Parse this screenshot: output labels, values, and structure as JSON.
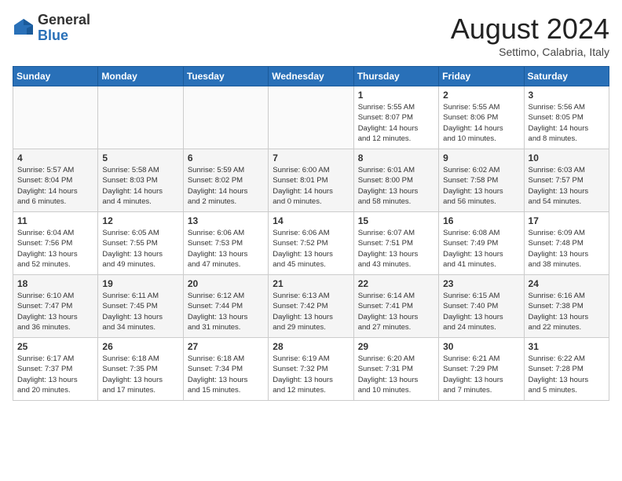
{
  "header": {
    "logo_general": "General",
    "logo_blue": "Blue",
    "month_title": "August 2024",
    "location": "Settimo, Calabria, Italy"
  },
  "days_of_week": [
    "Sunday",
    "Monday",
    "Tuesday",
    "Wednesday",
    "Thursday",
    "Friday",
    "Saturday"
  ],
  "weeks": [
    {
      "days": [
        {
          "num": "",
          "empty": true
        },
        {
          "num": "",
          "empty": true
        },
        {
          "num": "",
          "empty": true
        },
        {
          "num": "",
          "empty": true
        },
        {
          "num": "1",
          "lines": [
            "Sunrise: 5:55 AM",
            "Sunset: 8:07 PM",
            "Daylight: 14 hours",
            "and 12 minutes."
          ]
        },
        {
          "num": "2",
          "lines": [
            "Sunrise: 5:55 AM",
            "Sunset: 8:06 PM",
            "Daylight: 14 hours",
            "and 10 minutes."
          ]
        },
        {
          "num": "3",
          "lines": [
            "Sunrise: 5:56 AM",
            "Sunset: 8:05 PM",
            "Daylight: 14 hours",
            "and 8 minutes."
          ]
        }
      ]
    },
    {
      "days": [
        {
          "num": "4",
          "lines": [
            "Sunrise: 5:57 AM",
            "Sunset: 8:04 PM",
            "Daylight: 14 hours",
            "and 6 minutes."
          ]
        },
        {
          "num": "5",
          "lines": [
            "Sunrise: 5:58 AM",
            "Sunset: 8:03 PM",
            "Daylight: 14 hours",
            "and 4 minutes."
          ]
        },
        {
          "num": "6",
          "lines": [
            "Sunrise: 5:59 AM",
            "Sunset: 8:02 PM",
            "Daylight: 14 hours",
            "and 2 minutes."
          ]
        },
        {
          "num": "7",
          "lines": [
            "Sunrise: 6:00 AM",
            "Sunset: 8:01 PM",
            "Daylight: 14 hours",
            "and 0 minutes."
          ]
        },
        {
          "num": "8",
          "lines": [
            "Sunrise: 6:01 AM",
            "Sunset: 8:00 PM",
            "Daylight: 13 hours",
            "and 58 minutes."
          ]
        },
        {
          "num": "9",
          "lines": [
            "Sunrise: 6:02 AM",
            "Sunset: 7:58 PM",
            "Daylight: 13 hours",
            "and 56 minutes."
          ]
        },
        {
          "num": "10",
          "lines": [
            "Sunrise: 6:03 AM",
            "Sunset: 7:57 PM",
            "Daylight: 13 hours",
            "and 54 minutes."
          ]
        }
      ]
    },
    {
      "days": [
        {
          "num": "11",
          "lines": [
            "Sunrise: 6:04 AM",
            "Sunset: 7:56 PM",
            "Daylight: 13 hours",
            "and 52 minutes."
          ]
        },
        {
          "num": "12",
          "lines": [
            "Sunrise: 6:05 AM",
            "Sunset: 7:55 PM",
            "Daylight: 13 hours",
            "and 49 minutes."
          ]
        },
        {
          "num": "13",
          "lines": [
            "Sunrise: 6:06 AM",
            "Sunset: 7:53 PM",
            "Daylight: 13 hours",
            "and 47 minutes."
          ]
        },
        {
          "num": "14",
          "lines": [
            "Sunrise: 6:06 AM",
            "Sunset: 7:52 PM",
            "Daylight: 13 hours",
            "and 45 minutes."
          ]
        },
        {
          "num": "15",
          "lines": [
            "Sunrise: 6:07 AM",
            "Sunset: 7:51 PM",
            "Daylight: 13 hours",
            "and 43 minutes."
          ]
        },
        {
          "num": "16",
          "lines": [
            "Sunrise: 6:08 AM",
            "Sunset: 7:49 PM",
            "Daylight: 13 hours",
            "and 41 minutes."
          ]
        },
        {
          "num": "17",
          "lines": [
            "Sunrise: 6:09 AM",
            "Sunset: 7:48 PM",
            "Daylight: 13 hours",
            "and 38 minutes."
          ]
        }
      ]
    },
    {
      "days": [
        {
          "num": "18",
          "lines": [
            "Sunrise: 6:10 AM",
            "Sunset: 7:47 PM",
            "Daylight: 13 hours",
            "and 36 minutes."
          ]
        },
        {
          "num": "19",
          "lines": [
            "Sunrise: 6:11 AM",
            "Sunset: 7:45 PM",
            "Daylight: 13 hours",
            "and 34 minutes."
          ]
        },
        {
          "num": "20",
          "lines": [
            "Sunrise: 6:12 AM",
            "Sunset: 7:44 PM",
            "Daylight: 13 hours",
            "and 31 minutes."
          ]
        },
        {
          "num": "21",
          "lines": [
            "Sunrise: 6:13 AM",
            "Sunset: 7:42 PM",
            "Daylight: 13 hours",
            "and 29 minutes."
          ]
        },
        {
          "num": "22",
          "lines": [
            "Sunrise: 6:14 AM",
            "Sunset: 7:41 PM",
            "Daylight: 13 hours",
            "and 27 minutes."
          ]
        },
        {
          "num": "23",
          "lines": [
            "Sunrise: 6:15 AM",
            "Sunset: 7:40 PM",
            "Daylight: 13 hours",
            "and 24 minutes."
          ]
        },
        {
          "num": "24",
          "lines": [
            "Sunrise: 6:16 AM",
            "Sunset: 7:38 PM",
            "Daylight: 13 hours",
            "and 22 minutes."
          ]
        }
      ]
    },
    {
      "days": [
        {
          "num": "25",
          "lines": [
            "Sunrise: 6:17 AM",
            "Sunset: 7:37 PM",
            "Daylight: 13 hours",
            "and 20 minutes."
          ]
        },
        {
          "num": "26",
          "lines": [
            "Sunrise: 6:18 AM",
            "Sunset: 7:35 PM",
            "Daylight: 13 hours",
            "and 17 minutes."
          ]
        },
        {
          "num": "27",
          "lines": [
            "Sunrise: 6:18 AM",
            "Sunset: 7:34 PM",
            "Daylight: 13 hours",
            "and 15 minutes."
          ]
        },
        {
          "num": "28",
          "lines": [
            "Sunrise: 6:19 AM",
            "Sunset: 7:32 PM",
            "Daylight: 13 hours",
            "and 12 minutes."
          ]
        },
        {
          "num": "29",
          "lines": [
            "Sunrise: 6:20 AM",
            "Sunset: 7:31 PM",
            "Daylight: 13 hours",
            "and 10 minutes."
          ]
        },
        {
          "num": "30",
          "lines": [
            "Sunrise: 6:21 AM",
            "Sunset: 7:29 PM",
            "Daylight: 13 hours",
            "and 7 minutes."
          ]
        },
        {
          "num": "31",
          "lines": [
            "Sunrise: 6:22 AM",
            "Sunset: 7:28 PM",
            "Daylight: 13 hours",
            "and 5 minutes."
          ]
        }
      ]
    }
  ]
}
